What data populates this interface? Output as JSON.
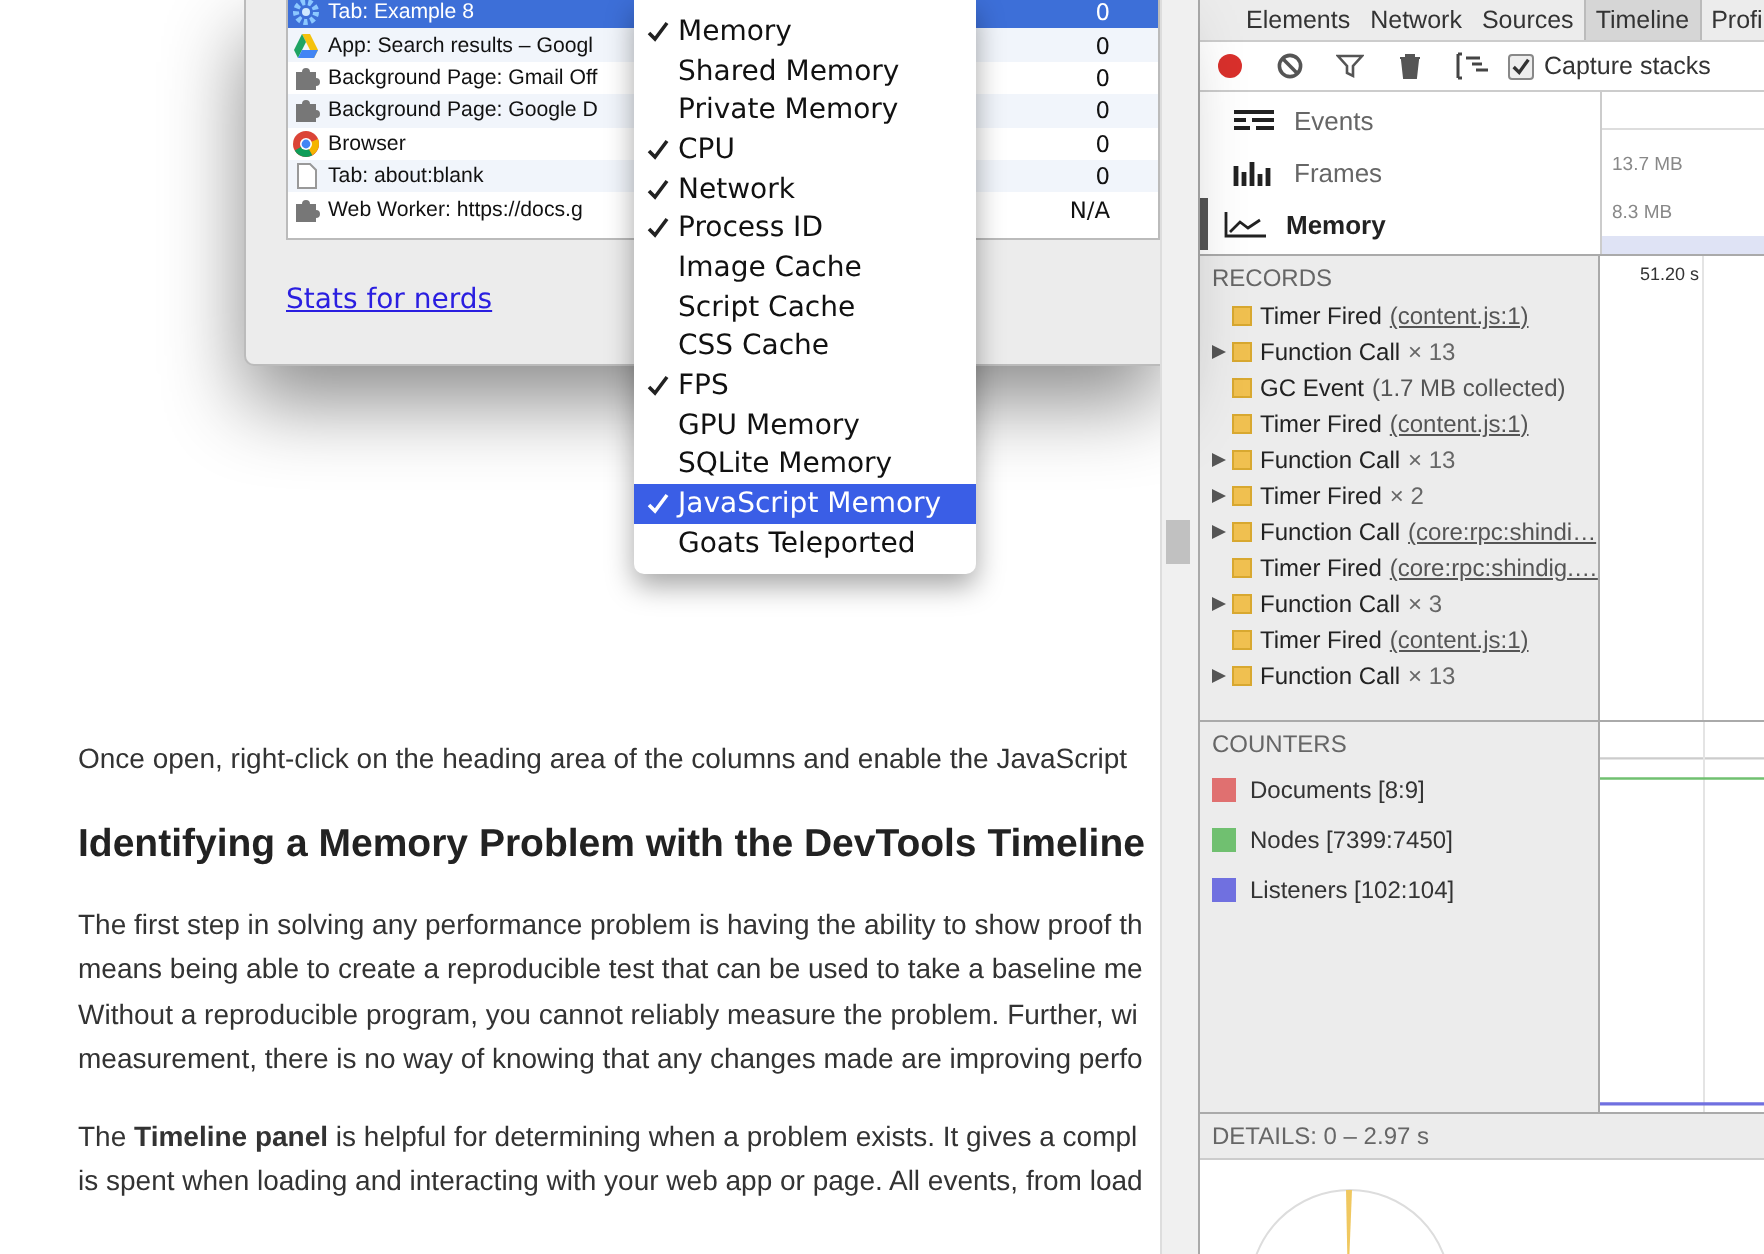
{
  "task_manager": {
    "rows": [
      {
        "name": "Tab: Example 8",
        "value": "0",
        "selected": true
      },
      {
        "name": "App: Search results – Googl",
        "value": "0",
        "selected": false
      },
      {
        "name": "Background Page: Gmail Off",
        "value": "0",
        "selected": false
      },
      {
        "name": "Background Page: Google D",
        "value": "0",
        "selected": false
      },
      {
        "name": "Browser",
        "value": "0",
        "selected": false
      },
      {
        "name": "Tab: about:blank",
        "value": "0",
        "selected": false
      },
      {
        "name": "Web Worker: https://docs.g",
        "value": "N/A",
        "selected": false
      }
    ],
    "link": "Stats for nerds"
  },
  "column_menu": [
    {
      "label": "Memory",
      "checked": true,
      "selected": false
    },
    {
      "label": "Shared Memory",
      "checked": false,
      "selected": false
    },
    {
      "label": "Private Memory",
      "checked": false,
      "selected": false
    },
    {
      "label": "CPU",
      "checked": true,
      "selected": false
    },
    {
      "label": "Network",
      "checked": true,
      "selected": false
    },
    {
      "label": "Process ID",
      "checked": true,
      "selected": false
    },
    {
      "label": "Image Cache",
      "checked": false,
      "selected": false
    },
    {
      "label": "Script Cache",
      "checked": false,
      "selected": false
    },
    {
      "label": "CSS Cache",
      "checked": false,
      "selected": false
    },
    {
      "label": "FPS",
      "checked": true,
      "selected": false
    },
    {
      "label": "GPU Memory",
      "checked": false,
      "selected": false
    },
    {
      "label": "SQLite Memory",
      "checked": false,
      "selected": false
    },
    {
      "label": "JavaScript Memory",
      "checked": true,
      "selected": true
    },
    {
      "label": "Goats Teleported",
      "checked": false,
      "selected": false
    }
  ],
  "article": [
    {
      "kind": "paragraph",
      "lines": [
        "Once open, right-click on the heading area of the columns and enable the JavaScript"
      ]
    },
    {
      "kind": "heading",
      "lines": [
        "Identifying a Memory Problem with the DevTools Timeline"
      ]
    },
    {
      "kind": "paragraph",
      "lines": [
        "The first step in solving any performance problem is having the ability to show proof th",
        "means being able to create a reproducible test that can be used to take a baseline me",
        "Without a reproducible program, you cannot reliably measure the problem. Further, wi",
        "measurement, there is no way of knowing that any changes made are improving perfo"
      ]
    },
    {
      "kind": "paragraph",
      "lines": [
        "The **Timeline panel** is helpful for determining when a problem exists. It gives a compl",
        "is spent when loading and interacting with your web app or page. All events, from load"
      ]
    }
  ],
  "devtools": {
    "tabs": [
      {
        "label": "Elements",
        "selected": false
      },
      {
        "label": "Network",
        "selected": false
      },
      {
        "label": "Sources",
        "selected": false
      },
      {
        "label": "Timeline",
        "selected": true
      },
      {
        "label": "Profi",
        "selected": false
      }
    ],
    "capture_stacks": {
      "label": "Capture stacks",
      "checked": true
    },
    "modes": [
      {
        "label": "Events",
        "selected": false
      },
      {
        "label": "Frames",
        "selected": false
      },
      {
        "label": "Memory",
        "selected": true
      }
    ],
    "overview_labels": [
      "13.7 MB",
      "8.3 MB"
    ],
    "records_title": "RECORDS",
    "time_label": "51.20 s",
    "records": [
      {
        "expandable": false,
        "name": "Timer Fired",
        "link": "(content.js:1)"
      },
      {
        "expandable": true,
        "name": "Function Call",
        "count": "× 13"
      },
      {
        "expandable": false,
        "name": "GC Event",
        "note": "(1.7 MB collected)"
      },
      {
        "expandable": false,
        "name": "Timer Fired",
        "link": "(content.js:1)"
      },
      {
        "expandable": true,
        "name": "Function Call",
        "count": "× 13"
      },
      {
        "expandable": true,
        "name": "Timer Fired",
        "count": "× 2"
      },
      {
        "expandable": true,
        "name": "Function Call",
        "link": "(core:rpc:shindi…"
      },
      {
        "expandable": false,
        "name": "Timer Fired",
        "link": "(core:rpc:shindig.…"
      },
      {
        "expandable": true,
        "name": "Function Call",
        "count": "× 3"
      },
      {
        "expandable": false,
        "name": "Timer Fired",
        "link": "(content.js:1)"
      },
      {
        "expandable": true,
        "name": "Function Call",
        "count": "× 13"
      }
    ],
    "counters_title": "COUNTERS",
    "counters": [
      {
        "label": "Documents [8:9]",
        "color": "#e07070"
      },
      {
        "label": "Nodes [7399:7450]",
        "color": "#70c070"
      },
      {
        "label": "Listeners [102:104]",
        "color": "#7070e0"
      }
    ],
    "details": "DETAILS: 0 – 2.97 s"
  }
}
